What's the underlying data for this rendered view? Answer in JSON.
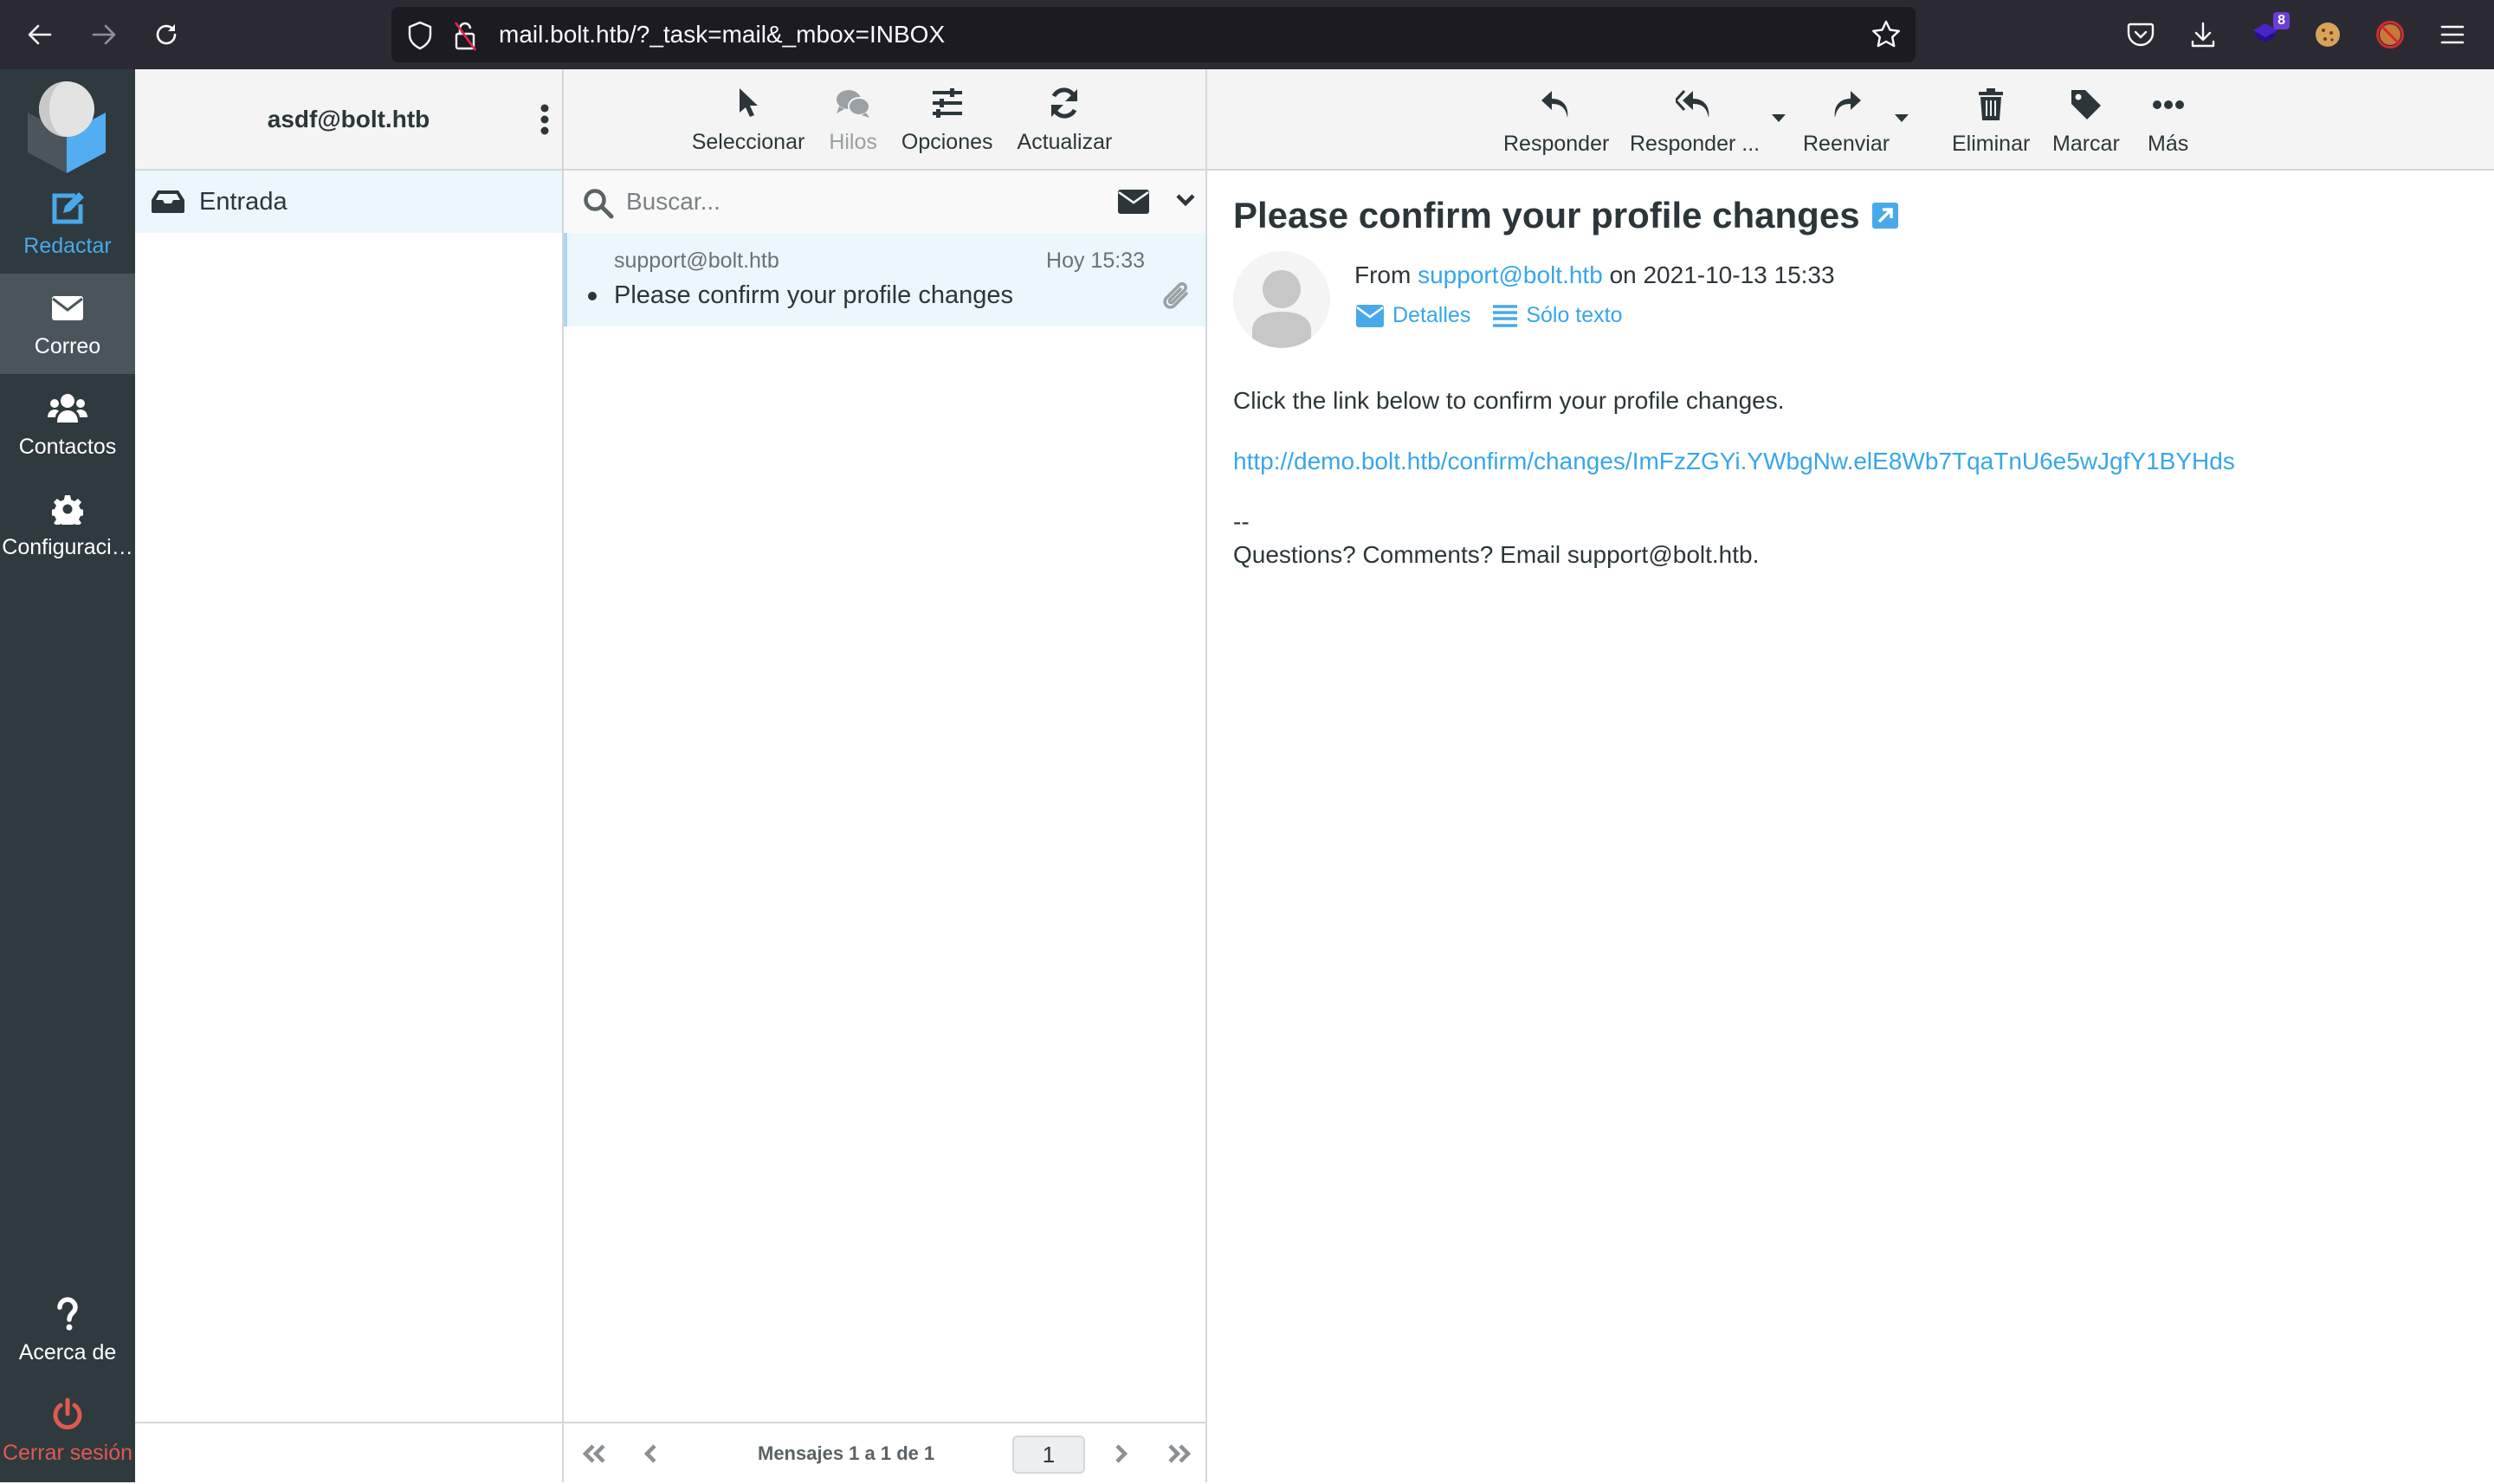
{
  "browser": {
    "url": "mail.bolt.htb/?_task=mail&_mbox=INBOX",
    "extension_badge": "8",
    "icons": [
      "back-icon",
      "forward-icon",
      "reload-icon",
      "shield-icon",
      "insecure-lock-icon",
      "bookmark-star-icon",
      "pocket-icon",
      "download-icon",
      "extension-icon",
      "cookie-icon",
      "blocked-extension-icon",
      "menu-icon"
    ]
  },
  "nav": {
    "items": [
      {
        "label": "Redactar",
        "icon": "compose-icon"
      },
      {
        "label": "Correo",
        "icon": "mail-icon",
        "active": true
      },
      {
        "label": "Contactos",
        "icon": "contacts-icon"
      },
      {
        "label": "Configuraci…",
        "icon": "gear-icon"
      },
      {
        "label": "Acerca de",
        "icon": "question-icon"
      },
      {
        "label": "Cerrar sesión",
        "icon": "power-icon"
      }
    ]
  },
  "folders": {
    "account": "asdf@bolt.htb",
    "items": [
      {
        "label": "Entrada",
        "icon": "inbox-icon",
        "selected": true
      }
    ]
  },
  "message_list": {
    "toolbar": [
      {
        "label": "Seleccionar",
        "icon": "pointer-icon"
      },
      {
        "label": "Hilos",
        "icon": "threads-icon",
        "disabled": true
      },
      {
        "label": "Opciones",
        "icon": "sliders-icon"
      },
      {
        "label": "Actualizar",
        "icon": "refresh-icon"
      }
    ],
    "search_placeholder": "Buscar...",
    "messages": [
      {
        "from": "support@bolt.htb",
        "date": "Hoy 15:33",
        "subject": "Please confirm your profile changes",
        "unread": true,
        "attachment": true
      }
    ],
    "pagination": {
      "count_text": "Mensajes 1 a 1 de 1",
      "page": "1"
    }
  },
  "reader": {
    "toolbar": [
      {
        "label": "Responder",
        "icon": "reply-icon"
      },
      {
        "label": "Responder ...",
        "icon": "reply-all-icon",
        "dropdown": true
      },
      {
        "label": "Reenviar",
        "icon": "forward-mail-icon",
        "dropdown": true
      },
      {
        "label": "Eliminar",
        "icon": "trash-icon"
      },
      {
        "label": "Marcar",
        "icon": "tag-icon"
      },
      {
        "label": "Más",
        "icon": "more-icon"
      }
    ],
    "subject": "Please confirm your profile changes",
    "from_prefix": "From",
    "from_address": "support@bolt.htb",
    "date_text": "on 2021-10-13 15:33",
    "details_label": "Detalles",
    "plaintext_label": "Sólo texto",
    "body": {
      "line1": "Click the link below to confirm your profile changes.",
      "link": "http://demo.bolt.htb/confirm/changes/ImFzZGYi.YWbgNw.elE8Wb7TqaTnU6e5wJgfY1BYHds",
      "sig_sep": "--",
      "signature": "Questions? Comments? Email support@bolt.htb."
    }
  },
  "colors": {
    "accent": "#37a6ea",
    "sidebar_bg": "#2f3a3f",
    "logout": "#e05a4e",
    "selected_bg": "#ebf6fd"
  }
}
